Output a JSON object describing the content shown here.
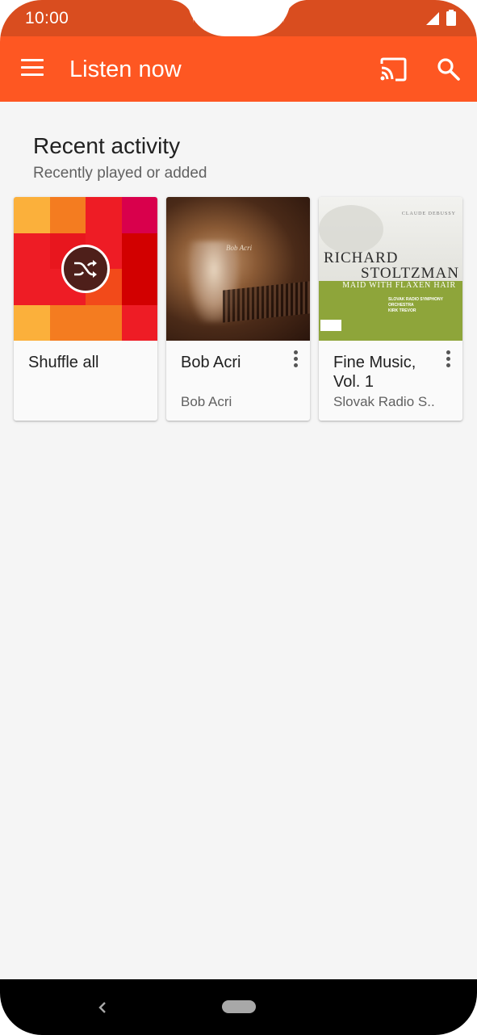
{
  "status_bar": {
    "time": "10:00",
    "icons": [
      "signal-icon",
      "battery-icon"
    ]
  },
  "app_bar": {
    "title": "Listen now",
    "icons": [
      "menu-icon",
      "cast-icon",
      "search-icon"
    ],
    "color": "#fe5722",
    "status_color": "#d94d1f"
  },
  "section": {
    "title": "Recent activity",
    "subtitle": "Recently played or added"
  },
  "cards": [
    {
      "title": "Shuffle all",
      "subtitle": "",
      "has_menu": false,
      "art": "shuffle-mosaic"
    },
    {
      "title": "Bob Acri",
      "subtitle": "Bob Acri",
      "has_menu": true,
      "art": "bob-acri-album"
    },
    {
      "title": "Fine Music, Vol. 1",
      "subtitle": "Slovak Radio S..",
      "has_menu": true,
      "art": "debussy-album"
    }
  ],
  "album_art": {
    "bob": {
      "text": "Bob Acri"
    },
    "debussy": {
      "composer": "CLAUDE DEBUSSY",
      "artist_line1": "RICHARD",
      "artist_line2": "STOLTZMAN",
      "work": "MAID WITH FLAXEN HAIR",
      "orchestra": "SLOVAK RADIO SYMPHONY ORCHESTRA",
      "conductor": "KIRK TREVOR"
    }
  },
  "nav_bar": {
    "icons": [
      "back-icon",
      "home-pill"
    ]
  }
}
